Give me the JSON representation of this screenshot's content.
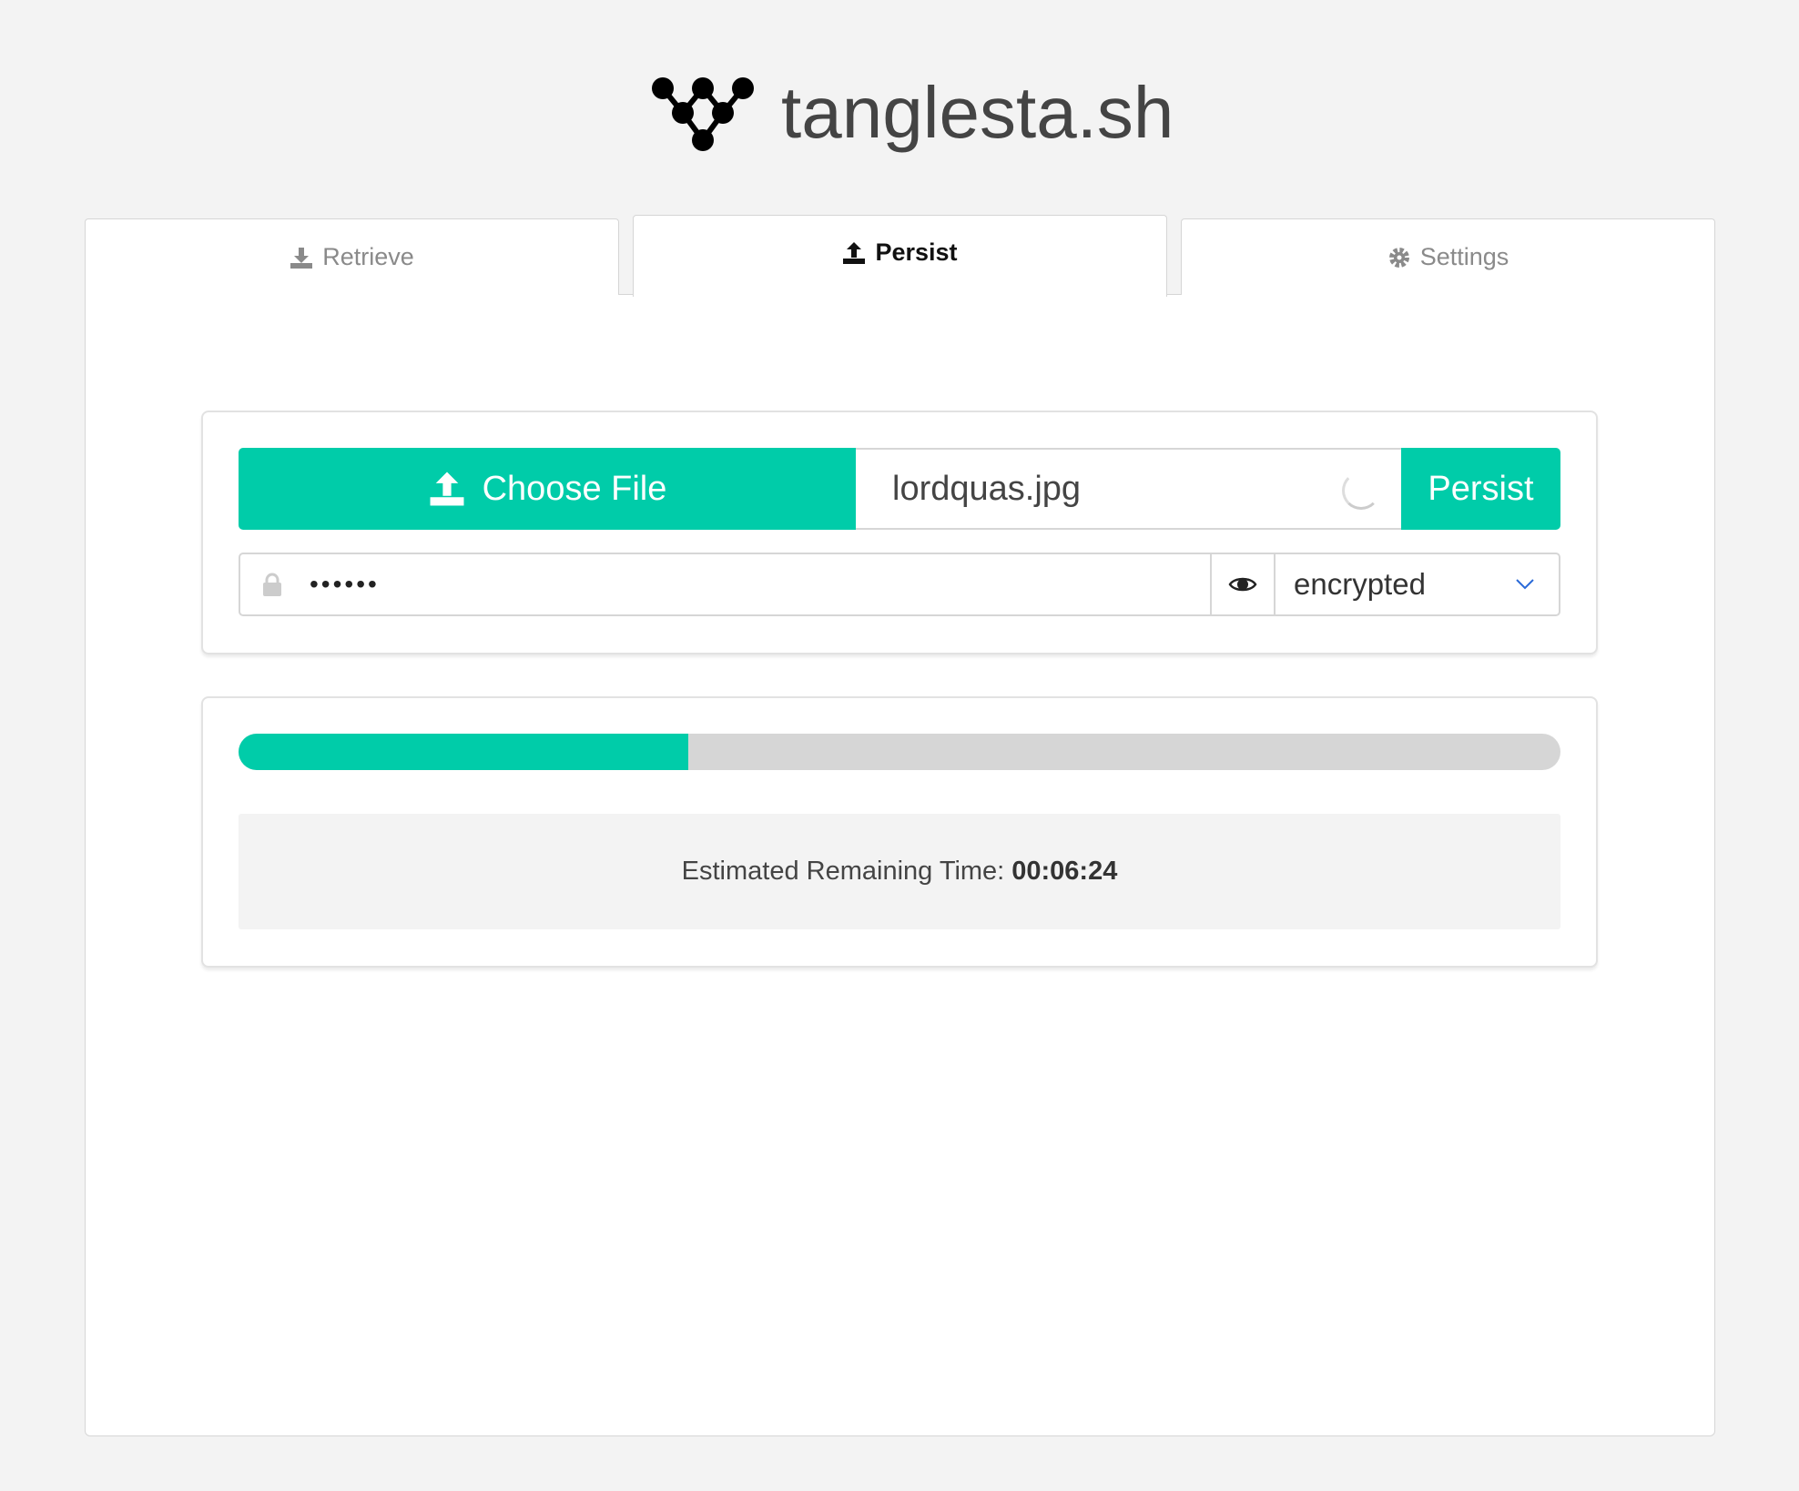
{
  "header": {
    "logo_text": "tanglesta.sh",
    "logo_icon": "tangle-graph-icon"
  },
  "tabs": [
    {
      "label": "Retrieve",
      "icon": "download-icon",
      "active": false
    },
    {
      "label": "Persist",
      "icon": "upload-icon",
      "active": true
    },
    {
      "label": "Settings",
      "icon": "gear-icon",
      "active": false
    }
  ],
  "upload": {
    "choose_label": "Choose File",
    "filename": "lordquas.jpg",
    "persist_label": "Persist"
  },
  "password": {
    "value": "••••••",
    "mode": "encrypted"
  },
  "progress": {
    "percent": 34,
    "eta_label": "Estimated Remaining Time:",
    "eta_value": "00:06:24"
  },
  "colors": {
    "accent": "#00cca9",
    "background": "#f3f3f3",
    "chevron": "#2a6ad8"
  }
}
